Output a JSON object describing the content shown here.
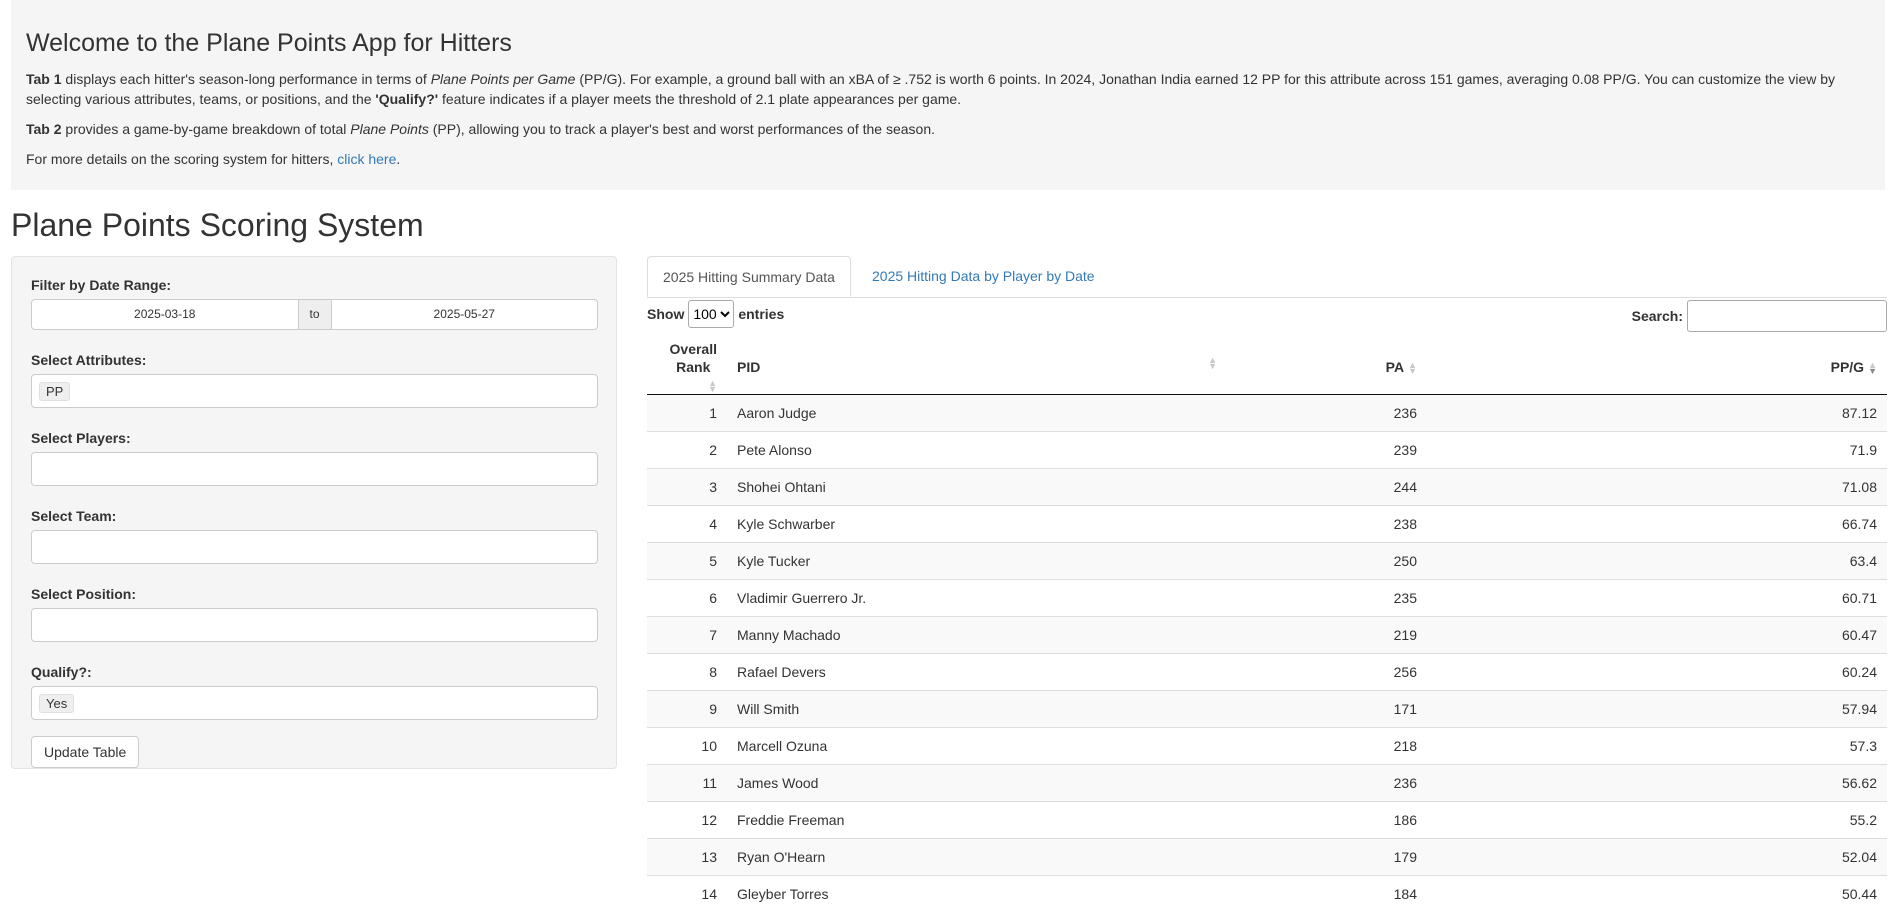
{
  "intro": {
    "title": "Welcome to the Plane Points App for Hitters",
    "p1": {
      "tab": "Tab 1",
      "t1": " displays each hitter's season-long performance in terms of ",
      "em": "Plane Points per Game",
      "t2": " (PP/G). For example, a ground ball with an xBA of ≥ .752 is worth 6 points. In 2024, Jonathan India earned 12 PP for this attribute across 151 games, averaging 0.08 PP/G. You can customize the view by selecting various attributes, teams, or positions, and the ",
      "strong": "'Qualify?'",
      "t3": " feature indicates if a player meets the threshold of 2.1 plate appearances per game."
    },
    "p2": {
      "tab": "Tab 2",
      "t1": " provides a game-by-game breakdown of total ",
      "em": "Plane Points",
      "t2": " (PP), allowing you to track a player's best and worst performances of the season."
    },
    "p3": {
      "t1": "For more details on the scoring system for hitters, ",
      "link": "click here",
      "t2": "."
    }
  },
  "page_title": "Plane Points Scoring System",
  "sidebar": {
    "date_label": "Filter by Date Range:",
    "date_start": "2025-03-18",
    "date_sep": "to",
    "date_end": "2025-05-27",
    "attributes_label": "Select Attributes:",
    "attributes_value": "PP",
    "players_label": "Select Players:",
    "team_label": "Select Team:",
    "position_label": "Select Position:",
    "qualify_label": "Qualify?:",
    "qualify_value": "Yes",
    "update_button": "Update Table"
  },
  "tabs": {
    "tab1": "2025 Hitting Summary Data",
    "tab2": "2025 Hitting Data by Player by Date"
  },
  "table_controls": {
    "show_label": "Show",
    "entries_value": "100",
    "entries_label": "entries",
    "search_label": "Search:"
  },
  "table": {
    "headers": {
      "rank_line1": "Overall",
      "rank_line2": "Rank",
      "pid": "PID",
      "pa": "PA",
      "ppg": "PP/G"
    },
    "rows": [
      {
        "rank": "1",
        "pid": "Aaron Judge",
        "pa": "236",
        "ppg": "87.12"
      },
      {
        "rank": "2",
        "pid": "Pete Alonso",
        "pa": "239",
        "ppg": "71.9"
      },
      {
        "rank": "3",
        "pid": "Shohei Ohtani",
        "pa": "244",
        "ppg": "71.08"
      },
      {
        "rank": "4",
        "pid": "Kyle Schwarber",
        "pa": "238",
        "ppg": "66.74"
      },
      {
        "rank": "5",
        "pid": "Kyle Tucker",
        "pa": "250",
        "ppg": "63.4"
      },
      {
        "rank": "6",
        "pid": "Vladimir Guerrero Jr.",
        "pa": "235",
        "ppg": "60.71"
      },
      {
        "rank": "7",
        "pid": "Manny Machado",
        "pa": "219",
        "ppg": "60.47"
      },
      {
        "rank": "8",
        "pid": "Rafael Devers",
        "pa": "256",
        "ppg": "60.24"
      },
      {
        "rank": "9",
        "pid": "Will Smith",
        "pa": "171",
        "ppg": "57.94"
      },
      {
        "rank": "10",
        "pid": "Marcell Ozuna",
        "pa": "218",
        "ppg": "57.3"
      },
      {
        "rank": "11",
        "pid": "James Wood",
        "pa": "236",
        "ppg": "56.62"
      },
      {
        "rank": "12",
        "pid": "Freddie Freeman",
        "pa": "186",
        "ppg": "55.2"
      },
      {
        "rank": "13",
        "pid": "Ryan O'Hearn",
        "pa": "179",
        "ppg": "52.04"
      },
      {
        "rank": "14",
        "pid": "Gleyber Torres",
        "pa": "184",
        "ppg": "50.44"
      }
    ]
  }
}
